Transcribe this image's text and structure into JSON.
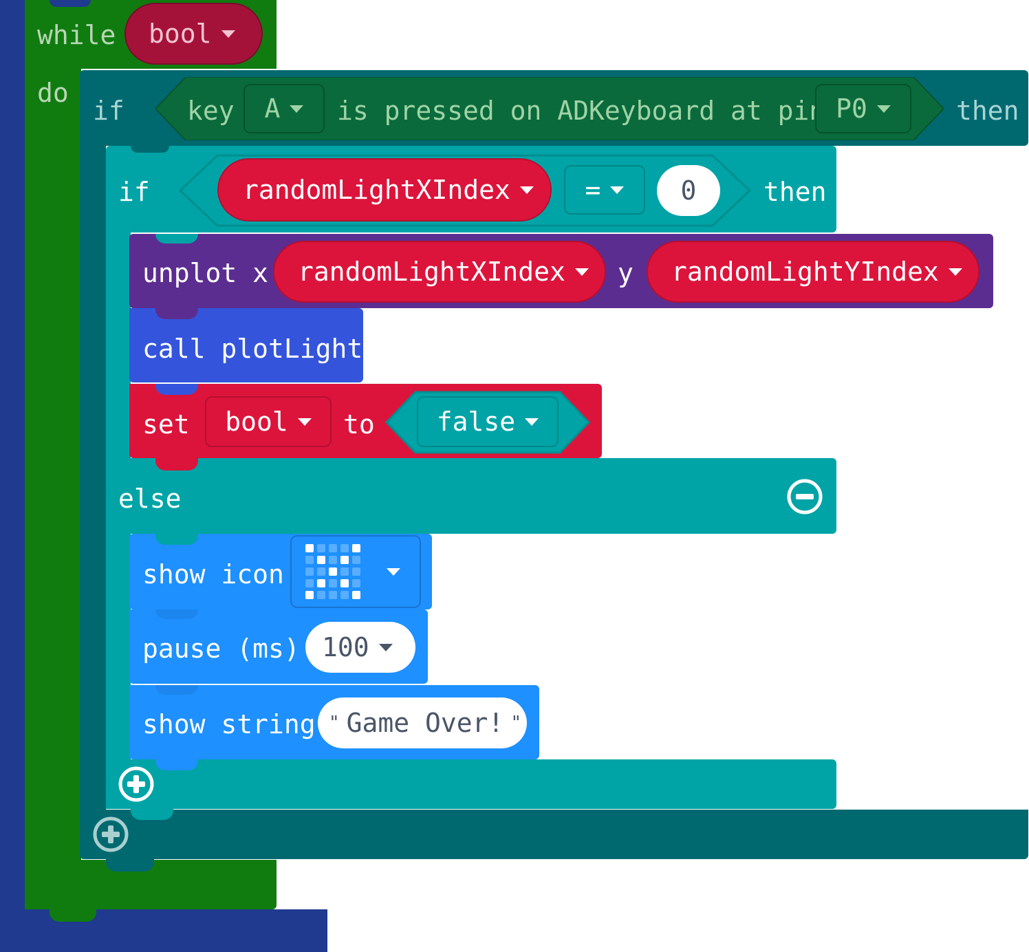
{
  "while_block": {
    "keyword": "while",
    "condition_var": "bool",
    "do_label": "do"
  },
  "if_outer": {
    "if_label": "if",
    "key_label": "key",
    "key_value": "A",
    "mid_text": "is pressed on ADKeyboard at pin",
    "pin_value": "P0",
    "then_label": "then"
  },
  "if_inner": {
    "if_label": "if",
    "var": "randomLightXIndex",
    "operator": "=",
    "compare_value": "0",
    "then_label": "then",
    "else_label": "else"
  },
  "unplot": {
    "label": "unplot x",
    "x_var": "randomLightXIndex",
    "y_label": "y",
    "y_var": "randomLightYIndex"
  },
  "call": {
    "label": "call plotLight"
  },
  "set_block": {
    "set_label": "set",
    "var": "bool",
    "to_label": "to",
    "value": "false"
  },
  "show_icon": {
    "label": "show icon",
    "icon": "x-pattern-icon"
  },
  "pause": {
    "label": "pause (ms)",
    "value": "100"
  },
  "show_string": {
    "label": "show string",
    "value": "Game Over!",
    "quote": "\""
  },
  "colors": {
    "workspace_blue": "#1f3a8f",
    "loop_green": "#107c10",
    "logic_teal_dark": "#006970",
    "logic_teal": "#00a4a6",
    "variable_red": "#dc143c",
    "led_purple": "#5c2d91",
    "function_blue": "#3455db",
    "basic_blue": "#1e90ff",
    "input_green": "#007a4b"
  }
}
